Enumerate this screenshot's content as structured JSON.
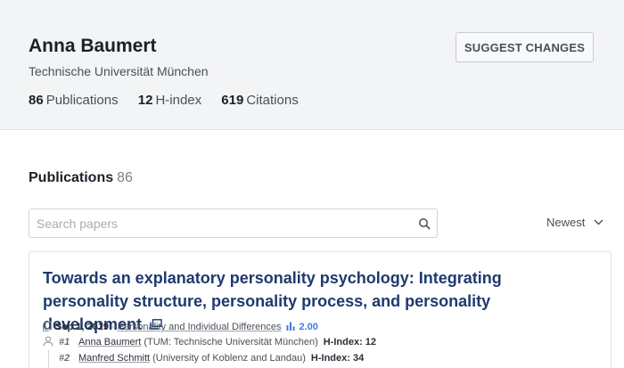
{
  "profile": {
    "name": "Anna Baumert",
    "affiliation": "Technische Universität München",
    "stats": [
      {
        "value": "86",
        "label": "Publications"
      },
      {
        "value": "12",
        "label": "H-index"
      },
      {
        "value": "619",
        "label": "Citations"
      }
    ],
    "suggest_label": "SUGGEST CHANGES"
  },
  "publications": {
    "heading": "Publications",
    "count": "86",
    "search_placeholder": "Search papers",
    "sort_label": "Newest"
  },
  "paper": {
    "title": "Towards an explanatory personality psychology: Integrating personality structure, personality process, and personality development",
    "date": "Sep 1, 2019",
    "journal": "Personality and Individual Differences",
    "metric": "2.00",
    "authors": [
      {
        "rank": "#1",
        "name": "Anna Baumert",
        "affiliation": "(TUM: Technische Universität München)",
        "hindex": "H-Index: 12"
      },
      {
        "rank": "#2",
        "name": "Manfred Schmitt",
        "affiliation": "(University of Koblenz and Landau)",
        "hindex": "H-Index: 34"
      }
    ]
  },
  "colors": {
    "link": "#1e3a6e",
    "metric": "#3d7be0",
    "header_bg": "#f3f4f6"
  },
  "icons": [
    "search-icon",
    "chevron-down-icon",
    "external-link-icon",
    "copy-icon",
    "bar-chart-icon",
    "person-icon"
  ]
}
